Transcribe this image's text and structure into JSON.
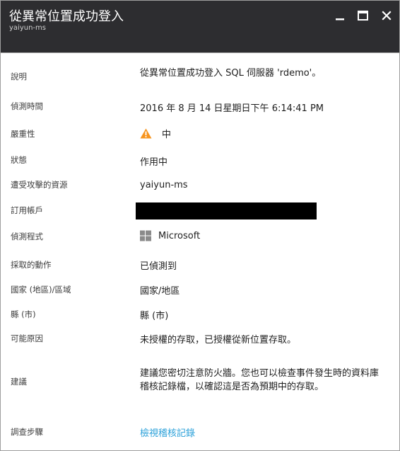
{
  "header": {
    "title": "從異常位置成功登入",
    "subtitle": "yaiyun-ms",
    "minimize_icon": "minimize-icon",
    "maximize_icon": "maximize-icon",
    "close_icon": "close-icon",
    "background": "#2d2d30"
  },
  "details": {
    "description": {
      "label": "說明",
      "value": "從異常位置成功登入 SQL 伺服器 'rdemo'。"
    },
    "detected_time": {
      "label": "偵測時間",
      "value": "2016 年 8 月 14 日星期日下午 6:14:41 PM"
    },
    "severity": {
      "label": "嚴重性",
      "value": "中",
      "icon": "warning-icon",
      "icon_color": "#f7941d"
    },
    "status": {
      "label": "狀態",
      "value": "作用中"
    },
    "attacked_resource": {
      "label": "遭受攻擊的資源",
      "value": "yaiyun-ms"
    },
    "subscription": {
      "label": "訂用帳戶",
      "value_redacted": true
    },
    "detected_by": {
      "label": "偵測程式",
      "value": "Microsoft",
      "icon": "windows-logo-icon"
    },
    "action_taken": {
      "label": "採取的動作",
      "value": "已偵測到"
    },
    "country": {
      "label": "國家 (地區)/區域",
      "value": "國家/地區"
    },
    "county": {
      "label": "縣 (市)",
      "value": "縣 (市)"
    },
    "possible_cause": {
      "label": "可能原因",
      "value": "未授權的存取，已授權從新位置存取。"
    },
    "recommendation": {
      "label": "建議",
      "value": "建議您密切注意防火牆。您也可以檢查事件發生時的資料庫稽核記錄檔，以確認這是否為預期中的存取。"
    },
    "investigation": {
      "label": "調查步驟",
      "value": "檢視稽核記錄",
      "link_color": "#2aa0d9"
    }
  }
}
